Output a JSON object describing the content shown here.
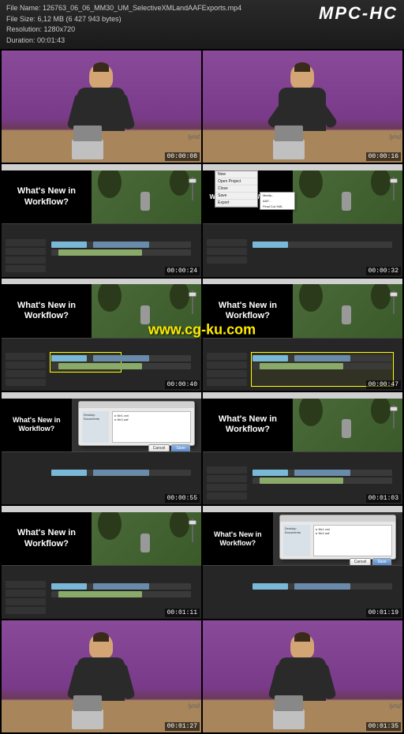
{
  "header": {
    "file_name_label": "File Name:",
    "file_name": "126763_06_06_MM30_UM_SelectiveXMLandAAFExports.mp4",
    "file_size_label": "File Size:",
    "file_size": "6,12 MB (6 427 943 bytes)",
    "resolution_label": "Resolution:",
    "resolution": "1280x720",
    "duration_label": "Duration:",
    "duration": "00:01:43",
    "player": "MPC-HC"
  },
  "panel_text": "What's New in Workflow?",
  "timecodes": [
    "00:00:08",
    "00:00:16",
    "00:00:24",
    "00:00:32",
    "00:00:40",
    "00:00:47",
    "00:00:55",
    "00:01:03",
    "00:01:11",
    "00:01:19",
    "00:01:27",
    "00:01:35"
  ],
  "watermark": "www.cg-ku.com",
  "thumb_brand": "lynd"
}
